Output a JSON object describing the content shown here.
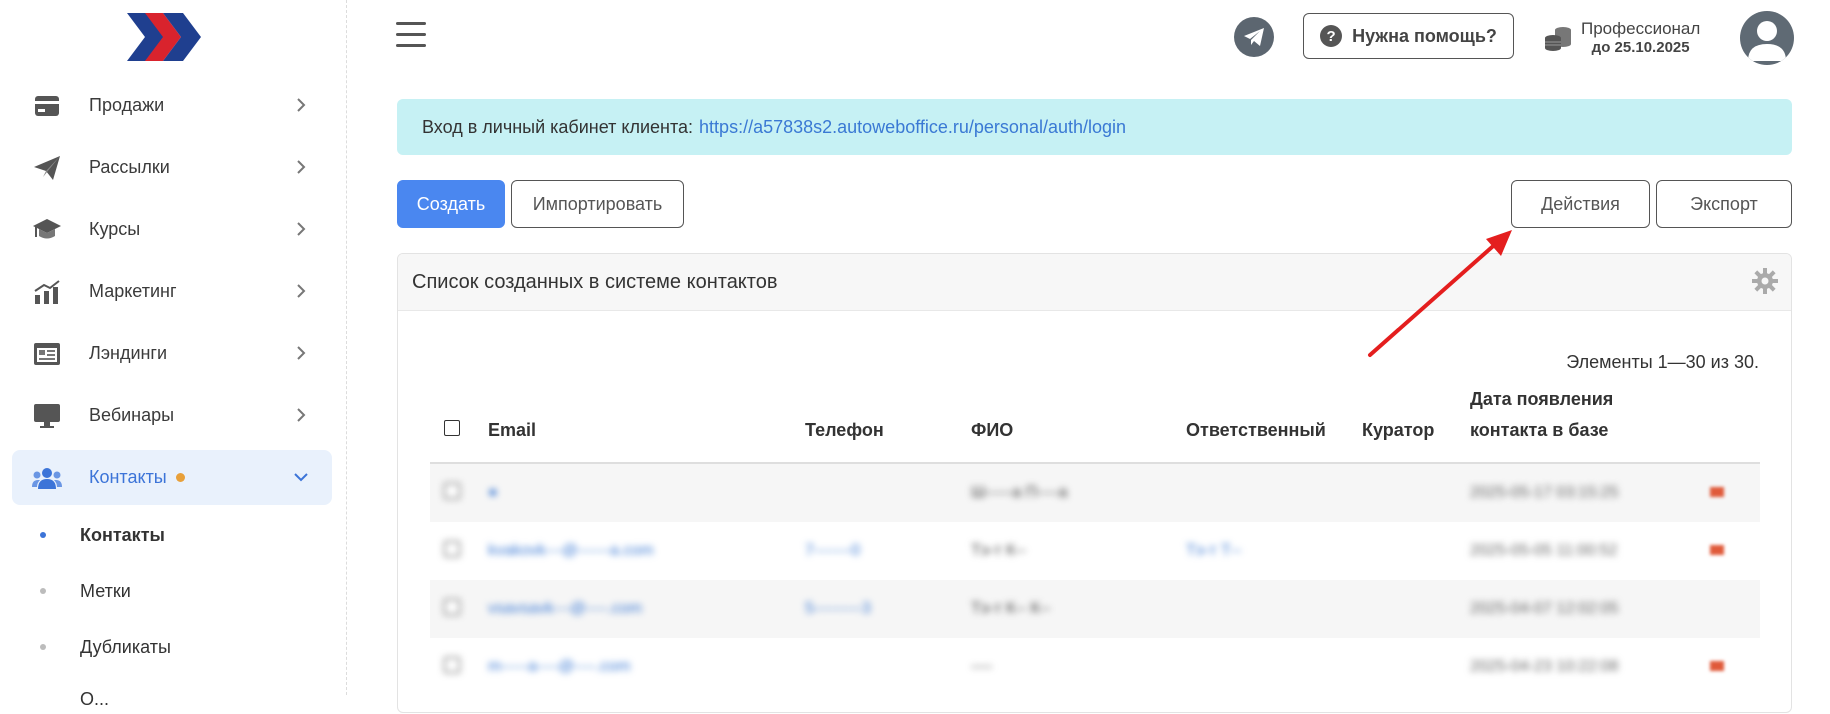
{
  "sidebar": {
    "items": [
      {
        "label": "Продажи",
        "icon": "credit-card-icon"
      },
      {
        "label": "Рассылки",
        "icon": "paper-plane-icon"
      },
      {
        "label": "Курсы",
        "icon": "graduation-cap-icon"
      },
      {
        "label": "Маркетинг",
        "icon": "bar-chart-icon"
      },
      {
        "label": "Лэндинги",
        "icon": "landing-page-icon"
      },
      {
        "label": "Вебинары",
        "icon": "monitor-icon"
      },
      {
        "label": "Контакты",
        "icon": "users-icon",
        "active": true
      }
    ],
    "subitems": [
      {
        "label": "Контакты",
        "active": true
      },
      {
        "label": "Метки"
      },
      {
        "label": "Дубликаты"
      },
      {
        "label": "О..."
      }
    ]
  },
  "header": {
    "help_label": "Нужна помощь?",
    "plan_name": "Профессионал",
    "plan_date": "до 25.10.2025"
  },
  "alert": {
    "text": "Вход в личный кабинет клиента:",
    "link": "https://a57838s2.autoweboffice.ru/personal/auth/login"
  },
  "toolbar": {
    "create_label": "Создать",
    "import_label": "Импортировать",
    "actions_label": "Действия",
    "export_label": "Экспорт"
  },
  "panel": {
    "title": "Список созданных в системе контактов",
    "counter": "Элементы 1—30 из 30."
  },
  "table": {
    "headers": {
      "email": "Email",
      "phone": "Телефон",
      "fio": "ФИО",
      "responsible": "Ответственный",
      "curator": "Куратор",
      "date_line1": "Дата появления",
      "date_line2": "контакта в базе"
    },
    "rows": [
      {
        "email": "",
        "phone": "",
        "fio": "Ш-----a П----a",
        "responsible": "",
        "date": "2025-05-17 03:15:25"
      },
      {
        "email": "kvakovk---@------a.com",
        "phone": "7-------0",
        "fio": "Тэ-т К--",
        "responsible": "Тэ-т Т--",
        "date": "2025-05-05 11:00:52"
      },
      {
        "email": "vsavsavk---@----.com",
        "phone": "5---------3",
        "fio": "Тэ-т К-- К--",
        "responsible": "",
        "date": "2025-04-07 12:02:05"
      },
      {
        "email": "m-----a----@----.com",
        "phone": "",
        "fio": "----",
        "responsible": "",
        "date": "2025-04-23 10:22:08"
      }
    ]
  }
}
